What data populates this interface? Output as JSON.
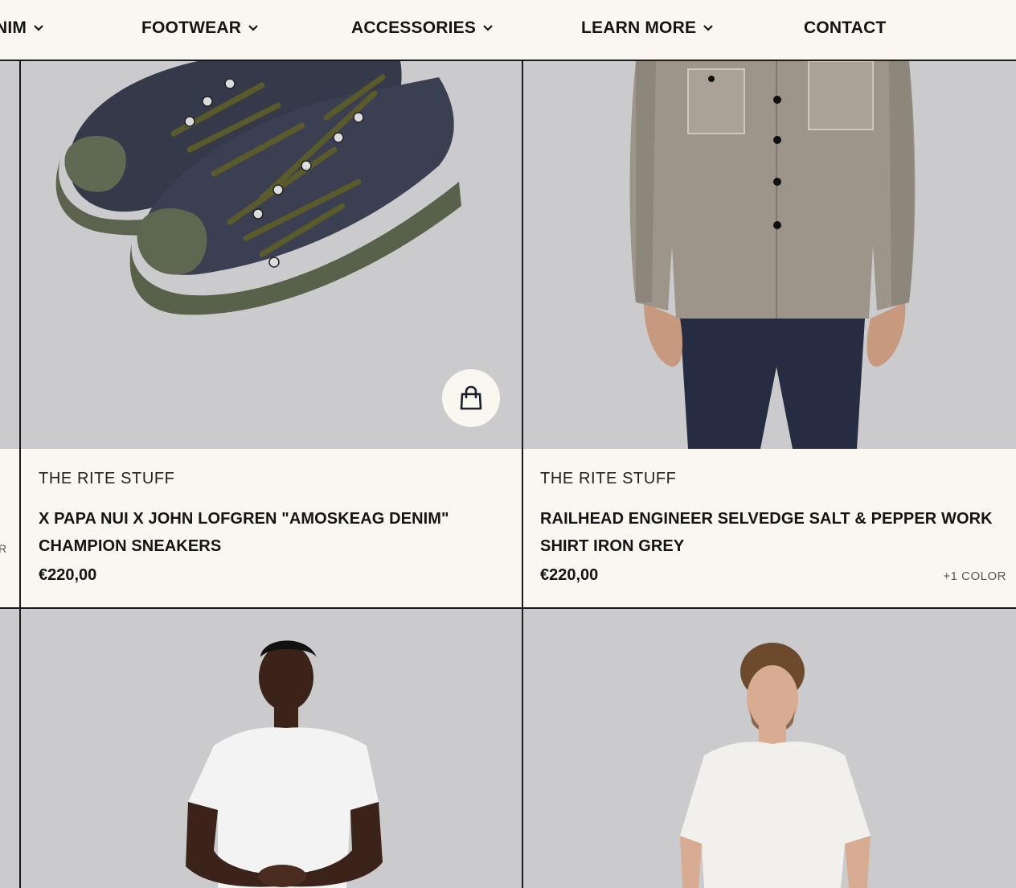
{
  "nav": {
    "items": [
      {
        "label": "NIM",
        "has_dropdown": true
      },
      {
        "label": "FOOTWEAR",
        "has_dropdown": true
      },
      {
        "label": "ACCESSORIES",
        "has_dropdown": true
      },
      {
        "label": "LEARN MORE",
        "has_dropdown": true
      },
      {
        "label": "CONTACT",
        "has_dropdown": false
      }
    ]
  },
  "left_strip": {
    "text": "R"
  },
  "products": [
    {
      "brand": "THE RITE STUFF",
      "title": "X PAPA NUI X JOHN LOFGREN \"AMOSKEAG DENIM\" CHAMPION SNEAKERS",
      "price": "€220,00",
      "colors": "",
      "image": "navy-denim-sneakers-olive-laces"
    },
    {
      "brand": "THE RITE STUFF",
      "title": "RAILHEAD ENGINEER SELVEDGE SALT & PEPPER WORK SHIRT IRON GREY",
      "price": "€220,00",
      "colors": "+1 COLOR",
      "image": "grey-work-shirt-model"
    },
    {
      "image": "white-tee-model-arms-crossed"
    },
    {
      "image": "white-tee-model-front"
    }
  ],
  "colors": {
    "background": "#faf7f0",
    "image_bg": "#cbcbcd",
    "text": "#141414",
    "border": "#1a1a1a"
  },
  "icons": {
    "bag": "shopping-bag-icon",
    "chevron": "chevron-down-icon"
  }
}
